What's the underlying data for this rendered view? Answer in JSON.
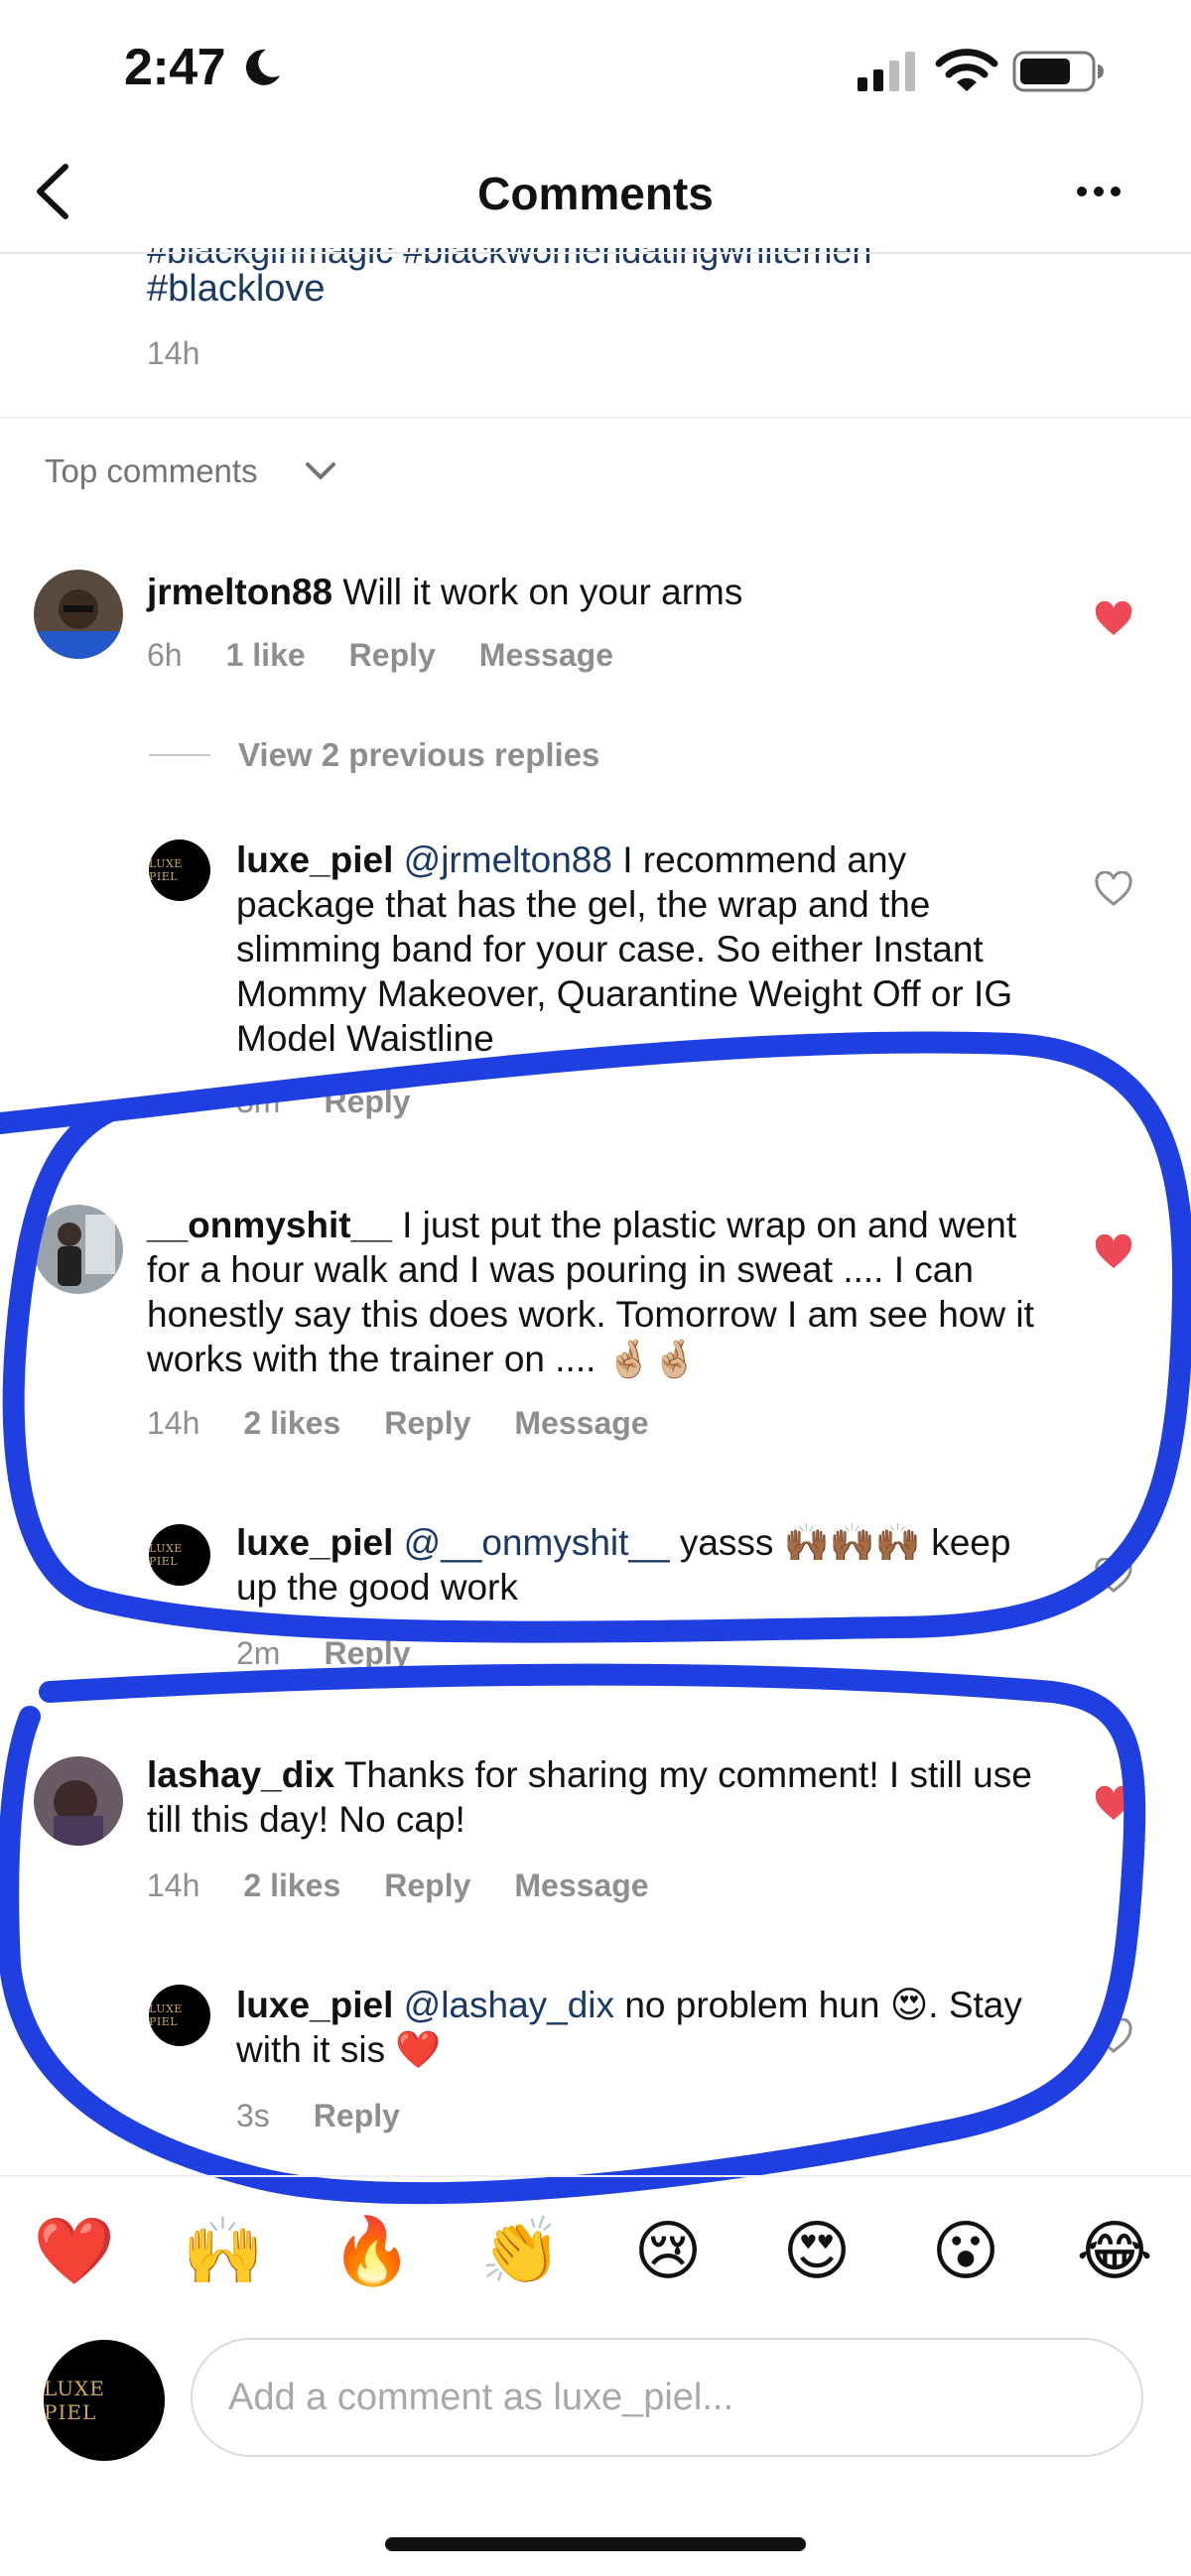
{
  "status_bar": {
    "time": "2:47"
  },
  "header": {
    "title": "Comments"
  },
  "caption": {
    "cut_text": "#blackgirlmagic #blackwomendatingwhitemen",
    "hashtag": "#blacklove",
    "time": "14h"
  },
  "sort": {
    "label": "Top comments"
  },
  "comments": [
    {
      "username": "jrmelton88",
      "text": "Will it work on your arms",
      "time": "6h",
      "likes": "1 like",
      "reply": "Reply",
      "message": "Message",
      "liked": true,
      "view_replies": "View 2 previous replies",
      "replies": [
        {
          "username": "luxe_piel",
          "mention": "@jrmelton88",
          "text": "I recommend any package that has the gel, the wrap and the slimming band for your case. So either Instant Mommy Makeover, Quarantine Weight Off or IG Model Waistline",
          "time": "3m",
          "reply": "Reply",
          "liked": false
        }
      ]
    },
    {
      "username": "__onmyshit__",
      "text": "I just put the plastic wrap on and went for a hour walk and I was pouring in sweat .... I can honestly say this does work. Tomorrow I am see how it works with the trainer on .... 🤞🏼🤞🏼",
      "time": "14h",
      "likes": "2 likes",
      "reply": "Reply",
      "message": "Message",
      "liked": true,
      "replies": [
        {
          "username": "luxe_piel",
          "mention": "@__onmyshit__",
          "text": "yasss 🙌🏾🙌🏾🙌🏾 keep up the good work",
          "time": "2m",
          "reply": "Reply",
          "liked": false
        }
      ]
    },
    {
      "username": "lashay_dix",
      "text": "Thanks for sharing my comment! I still use till this day! No cap!",
      "time": "14h",
      "likes": "2 likes",
      "reply": "Reply",
      "message": "Message",
      "liked": true,
      "replies": [
        {
          "username": "luxe_piel",
          "mention": "@lashay_dix",
          "text": "no problem hun 😍. Stay with it sis ❤️",
          "time": "3s",
          "reply": "Reply",
          "liked": false
        }
      ]
    }
  ],
  "reactions": [
    "❤️",
    "🙌",
    "🔥",
    "👏",
    "😢",
    "😍",
    "😮",
    "😂"
  ],
  "composer": {
    "placeholder": "Add a comment as luxe_piel..."
  },
  "brand_logo_text": "LUXE PIEL",
  "colors": {
    "like_red": "#ed4956",
    "mention_blue": "#1a3a63",
    "annotation_blue": "#1f3fe0"
  }
}
